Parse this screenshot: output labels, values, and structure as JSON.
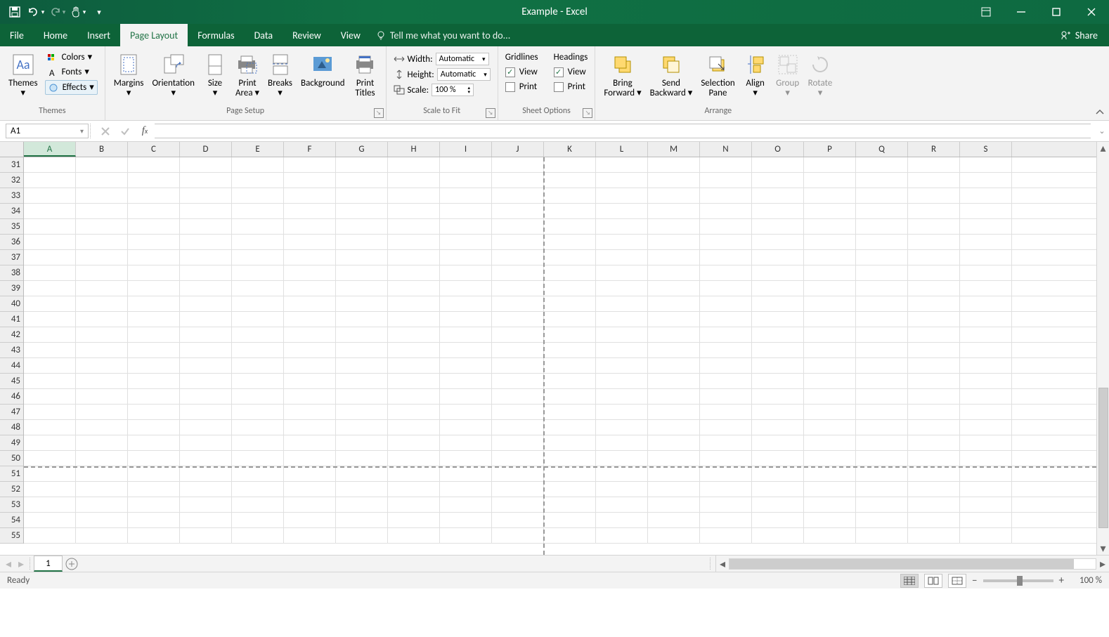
{
  "title": "Example - Excel",
  "qat": {
    "save": "",
    "undo": "",
    "redo": "",
    "touch": ""
  },
  "tabs": {
    "file": "File",
    "home": "Home",
    "insert": "Insert",
    "page_layout": "Page Layout",
    "formulas": "Formulas",
    "data": "Data",
    "review": "Review",
    "view": "View",
    "tell_me": "Tell me what you want to do..."
  },
  "share": "Share",
  "ribbon": {
    "themes": {
      "label": "Themes",
      "themes_btn": "Themes",
      "colors": "Colors",
      "fonts": "Fonts",
      "effects": "Effects"
    },
    "page_setup": {
      "label": "Page Setup",
      "margins": "Margins",
      "orientation": "Orientation",
      "size": "Size",
      "print_area": "Print\nArea",
      "breaks": "Breaks",
      "background": "Background",
      "print_titles": "Print\nTitles"
    },
    "scale": {
      "label": "Scale to Fit",
      "width_lbl": "Width:",
      "width_val": "Automatic",
      "height_lbl": "Height:",
      "height_val": "Automatic",
      "scale_lbl": "Scale:",
      "scale_val": "100 %"
    },
    "sheet_opts": {
      "label": "Sheet Options",
      "gridlines": "Gridlines",
      "headings": "Headings",
      "view": "View",
      "print": "Print",
      "grid_view": true,
      "grid_print": false,
      "head_view": true,
      "head_print": false
    },
    "arrange": {
      "label": "Arrange",
      "bring_forward": "Bring\nForward",
      "send_backward": "Send\nBackward",
      "selection_pane": "Selection\nPane",
      "align": "Align",
      "group": "Group",
      "rotate": "Rotate"
    }
  },
  "cell_ref": "A1",
  "columns": [
    "A",
    "B",
    "C",
    "D",
    "E",
    "F",
    "G",
    "H",
    "I",
    "J",
    "K",
    "L",
    "M",
    "N",
    "O",
    "P",
    "Q",
    "R",
    "S"
  ],
  "rows": [
    31,
    32,
    33,
    34,
    35,
    36,
    37,
    38,
    39,
    40,
    41,
    42,
    43,
    44,
    45,
    46,
    47,
    48,
    49,
    50,
    51,
    52,
    53,
    54,
    55
  ],
  "sheet_tab": "1",
  "status": "Ready",
  "zoom": "100 %"
}
